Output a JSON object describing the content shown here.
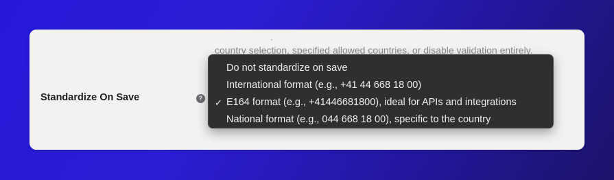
{
  "setting": {
    "description_partial": "country selection, specified allowed countries, or disable validation entirely.",
    "label": "Standardize On Save",
    "help_icon": "question-mark-icon",
    "help_glyph": "?"
  },
  "dropdown": {
    "selected_index": 2,
    "checkmark": "✓",
    "options": [
      {
        "label": "Do not standardize on save",
        "selected": false
      },
      {
        "label": "International format (e.g., +41 44 668 18 00)",
        "selected": false
      },
      {
        "label": "E164 format (e.g., +41446681800), ideal for APIs and integrations",
        "selected": true
      },
      {
        "label": "National format (e.g., 044 668 18 00), specific to the country",
        "selected": false
      }
    ]
  },
  "colors": {
    "background_gradient_start": "#2619d8",
    "background_gradient_end": "#1c146a",
    "card": "#f2f2f3",
    "menu": "#2f2f31",
    "menu_text": "#ececee"
  }
}
